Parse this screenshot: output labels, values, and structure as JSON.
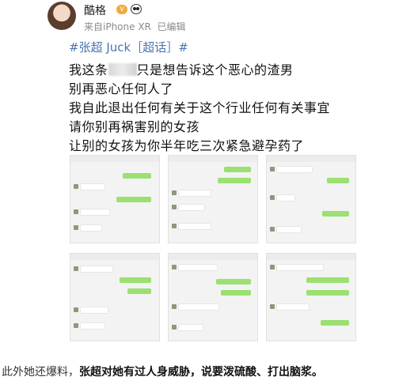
{
  "post": {
    "username": "酷格",
    "vip_label": "V",
    "device": "来自iPhone XR",
    "edited": "已编辑",
    "hashtag": "#张超 Juck［超话］#",
    "lines": [
      {
        "pre": "我这条",
        "post": "只是想告诉这个恶心的渣男"
      },
      {
        "text": "别再恶心任何人了"
      },
      {
        "text": "我自此退出任何有关于这个行业任何有关事宜"
      },
      {
        "text": "请你别再祸害别的女孩"
      },
      {
        "text": "让别的女孩为你半年吃三次紧急避孕药了"
      }
    ]
  },
  "caption": {
    "plain": "此外她还爆料，",
    "bold": "张超对她有过人身威胁，说要泼硫酸、打出脑浆。"
  },
  "colors": {
    "hashtag": "#4a74b0",
    "chat_bubble_green": "#9be070",
    "meta_gray": "#8a8a8a"
  }
}
